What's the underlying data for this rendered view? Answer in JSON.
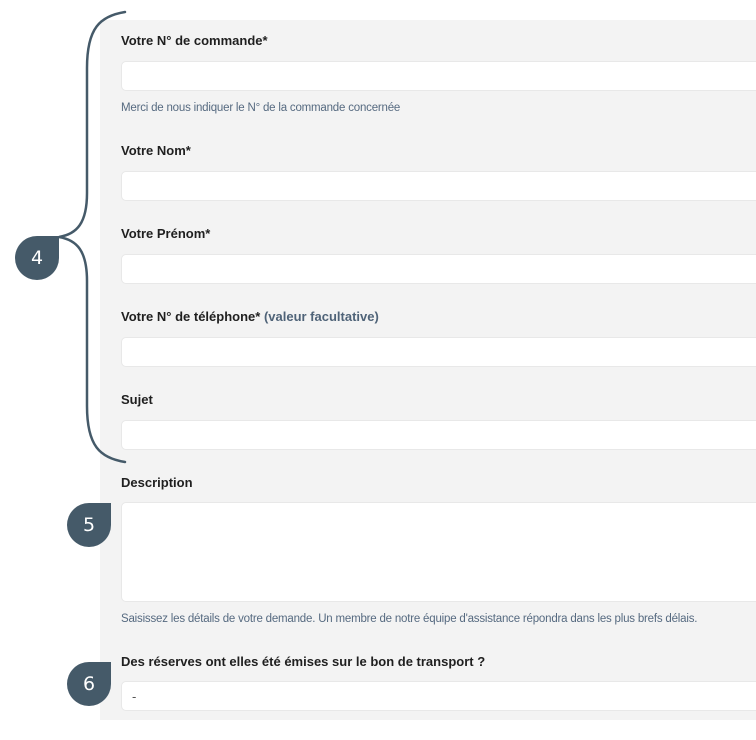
{
  "form": {
    "order_number": {
      "label": "Votre N° de commande*",
      "value": "",
      "hint": "Merci de nous indiquer le N° de la commande concernée"
    },
    "last_name": {
      "label": "Votre Nom*",
      "value": ""
    },
    "first_name": {
      "label": "Votre Prénom*",
      "value": ""
    },
    "phone": {
      "label": "Votre N° de téléphone*",
      "optional_note": "(valeur facultative)",
      "value": ""
    },
    "subject": {
      "label": "Sujet",
      "value": ""
    },
    "description": {
      "label": "Description",
      "value": "",
      "hint": "Saisissez les détails de votre demande. Un membre de notre équipe d'assistance répondra dans les plus brefs délais."
    },
    "reserves": {
      "label": "Des réserves ont elles été émises sur le bon de transport ?",
      "selected": "-"
    }
  },
  "annotations": {
    "badge_4": "4",
    "badge_5": "5",
    "badge_6": "6",
    "badge_color": "#455a69"
  }
}
